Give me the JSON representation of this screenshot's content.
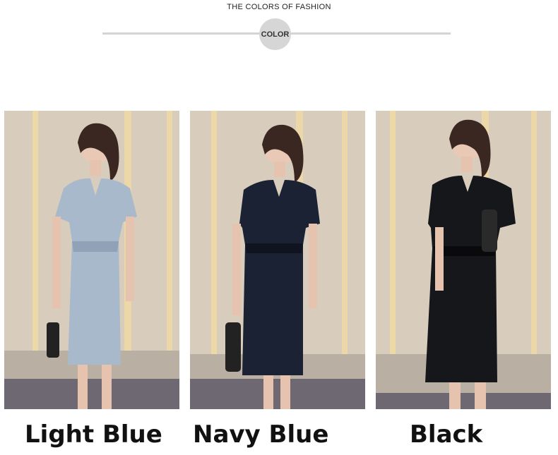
{
  "header": {
    "title": "THE COLORS OF FASHION",
    "badge": "COLOR"
  },
  "variants": [
    {
      "label": "Light Blue",
      "dress_color": "#a9b9cc",
      "dress_shade": "#8fa2b8"
    },
    {
      "label": "Navy Blue",
      "dress_color": "#1b2233",
      "dress_shade": "#0f1420"
    },
    {
      "label": "Black",
      "dress_color": "#16171a",
      "dress_shade": "#0a0a0c"
    }
  ],
  "colors": {
    "rule": "#d4d4d4",
    "badge_bg": "#d6d6d6",
    "backdrop": "#d9cfc0",
    "floor": "#6a6470"
  }
}
